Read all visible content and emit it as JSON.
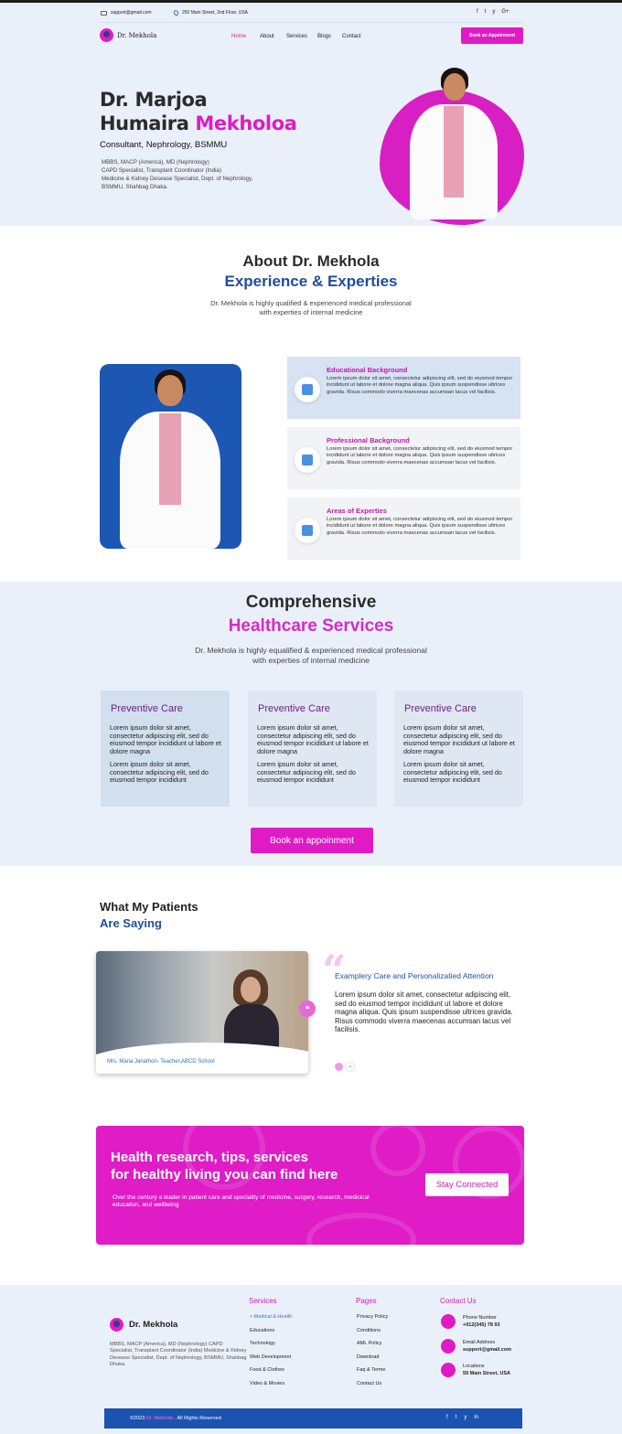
{
  "topbar": {
    "email": "support@gmail.com",
    "address": "250 Main Street, 2nd Floor, USA",
    "socials": [
      "f",
      "t",
      "y",
      "G+"
    ]
  },
  "nav": {
    "logo_text": "Dr. Mekhola",
    "items": [
      "Home",
      "About",
      "Services",
      "Blogs",
      "Contact"
    ],
    "cta": "Book an Appoinment"
  },
  "colors": {
    "accent": "#e01bc6",
    "brand_blue": "#1f4e9d",
    "bg_light": "#eaf0f9"
  },
  "hero": {
    "name_line1": "Dr. Marjoa",
    "name_line2_a": "Humaira ",
    "name_line2_b": "Mekholoa",
    "subtitle": "Consultant, Nephrology, BSMMU",
    "quals": [
      "MBBS, MACP (America), MD (Nephrology)",
      "CAPD Specialist, Transplant Coordinator (India)",
      "Medicine & Kidney Desease Specialist, Dept. of Nephrology,",
      "BSMMU, Shahbag Dhaka."
    ]
  },
  "about": {
    "title": "About Dr. Mekhola",
    "subtitle": "Experience & Experties",
    "desc": "Dr. Mekhola is highly qualified & experienced medical professional with experties of internal medicine",
    "cards": [
      {
        "title": "Educational Background",
        "body": "Lorem ipsum dolor sit amet, consectetur adipiscing elit, sed do eiusmod tempor incididunt ut labore et dolore magna aliqua. Quis ipsum suspendisse ultrices gravida. Risus commodo viverra maecenas accumsan lacus vel facilisis."
      },
      {
        "title": "Professional Background",
        "body": "Lorem ipsum dolor sit amet, consectetur adipiscing elit, sed do eiusmod tempor incididunt ut labore et dolore magna aliqua. Quis ipsum suspendisse ultrices gravida. Risus commodo viverra maecenas accumsan lacus vel facilisis."
      },
      {
        "title": "Areas of Experties",
        "body": "Lorem ipsum dolor sit amet, consectetur adipiscing elit, sed do eiusmod tempor incididunt ut labore et dolore magna aliqua. Quis ipsum suspendisse ultrices gravida. Risus commodo viverra maecenas accumsan lacus vel facilisis."
      }
    ]
  },
  "services": {
    "title": "Comprehensive",
    "subtitle": "Healthcare Services",
    "desc": "Dr. Mekhola is highly equalified & experienced medical professional with experties of internal medicine",
    "cards": [
      {
        "title": "Preventive Care",
        "p1": "Lorem ipsum dolor sit amet, consectetur adipiscing elit, sed do eiusmod tempor incididunt ut labore et dolore magna",
        "p2": "Lorem ipsum dolor sit amet, consectetur adipiscing elit, sed do eiusmod tempor incididunt"
      },
      {
        "title": "Preventive Care",
        "p1": "Lorem ipsum dolor sit amet, consectetur adipiscing elit, sed do eiusmod tempor incididunt ut labore et dolore magna",
        "p2": "Lorem ipsum dolor sit amet, consectetur adipiscing elit, sed do eiusmod tempor incididunt"
      },
      {
        "title": "Preventive Care",
        "p1": "Lorem ipsum dolor sit amet, consectetur adipiscing elit, sed do eiusmod tempor incididunt ut labore et dolore magna",
        "p2": "Lorem ipsum dolor sit amet, consectetur adipiscing elit, sed do eiusmod tempor incididunt"
      }
    ],
    "cta": "Book an appoinment"
  },
  "testimonials": {
    "title1": "What My Patients",
    "title2": "Are Saying",
    "caption": "Mrs. Maria Janathon- Teacher,ABCD School",
    "quote_title": "Examplery Care and Personalizatied Attention",
    "quote_body": "Lorem ipsum dolor sit amet, consectetur adipiscing elit, sed do eiusmod tempor incididunt ut labore et dolore magna aliqua. Quis ipsum suspendisse ultrices gravida. Risus commodo viverra maecenas accumsan lacus vel facilisis."
  },
  "banner": {
    "title_line1": "Health research, tips, services",
    "title_line2": "for healthy living you can find here",
    "sub": "Over the century a leader in patient care and speciality of medicine, surgery, research, medicical education, and wellbeing",
    "cta": "Stay Connected"
  },
  "footer": {
    "logo_text": "Dr. Mekhola",
    "desc": "MBBS, MACP (America), MD (Nephrology) CAPD Specialist, Transplant Coordinator (India) Medicine & Kidney Desease Specialist, Dept. of Nephrology, BSMMU, Shahbag Dhaka.",
    "services_title": "Services",
    "services": [
      "> Medical & Health",
      "Educations",
      "Technology",
      "Web Development",
      "Food & Clothes",
      "Video & Movies"
    ],
    "pages_title": "Pages",
    "pages": [
      "Privacy Policy",
      "Conditions",
      "AML Policy",
      "Download",
      "Faq & Terme",
      "Contact Us"
    ],
    "contact_title": "Contact Us",
    "contacts": [
      {
        "label": "Phone Number",
        "value": "+012(345) 78 93"
      },
      {
        "label": "Email Address",
        "value": "support@gmail.com"
      },
      {
        "label": "Locations",
        "value": "59 Main Street, USA"
      }
    ],
    "copy_a": "©2023 ",
    "copy_b": "Dr. Mekhola",
    "copy_c": " . All Rights Reserved",
    "socials": [
      "f",
      "t",
      "y",
      "in"
    ]
  }
}
